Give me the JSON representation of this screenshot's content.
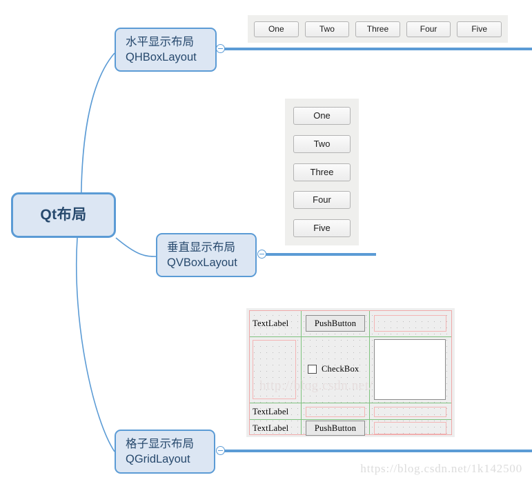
{
  "mindmap": {
    "root": {
      "label": "Qt布局"
    },
    "branches": [
      {
        "line1": "水平显示布局",
        "line2": "QHBoxLayout",
        "collapse_icon": "minus-circle-icon"
      },
      {
        "line1": "垂直显示布局",
        "line2": "QVBoxLayout",
        "collapse_icon": "minus-circle-icon"
      },
      {
        "line1": "格子显示布局",
        "line2": "QGridLayout",
        "collapse_icon": "minus-circle-icon"
      }
    ]
  },
  "examples": {
    "hbox": {
      "buttons": [
        "One",
        "Two",
        "Three",
        "Four",
        "Five"
      ]
    },
    "vbox": {
      "buttons": [
        "One",
        "Two",
        "Three",
        "Four",
        "Five"
      ]
    },
    "grid": {
      "labels": {
        "text_label": "TextLabel",
        "push_button": "PushButton",
        "check_box": "CheckBox"
      },
      "watermark": "http://blog.csdn.net/"
    }
  },
  "watermark": {
    "url": "https://blog.csdn.net/1k142500"
  },
  "colors": {
    "node_fill": "#dce6f3",
    "node_border": "#5b9bd5",
    "node_text": "#27496d",
    "connector": "#5b9bd5",
    "qt_panel": "#efefed",
    "grid_red": "#f0a8a8",
    "grid_green": "#7ec27e"
  }
}
